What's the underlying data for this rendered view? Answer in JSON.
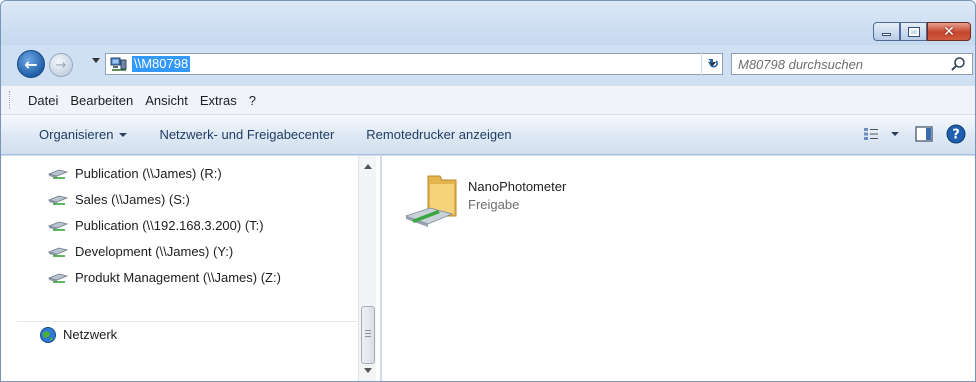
{
  "address": {
    "path": "\\\\M80798",
    "search_placeholder": "M80798 durchsuchen"
  },
  "menubar": {
    "items": [
      "Datei",
      "Bearbeiten",
      "Ansicht",
      "Extras",
      "?"
    ]
  },
  "commandbar": {
    "organize": "Organisieren",
    "network_center": "Netzwerk- und Freigabecenter",
    "remote_printers": "Remotedrucker anzeigen"
  },
  "navpane": {
    "drives": [
      "Publication (\\\\James) (R:)",
      "Sales (\\\\James) (S:)",
      "Publication (\\\\192.168.3.200) (T:)",
      "Development (\\\\James) (Y:)",
      "Produkt Management (\\\\James) (Z:)"
    ],
    "network_label": "Netzwerk"
  },
  "content": {
    "items": [
      {
        "name": "NanoPhotometer",
        "type": "Freigabe"
      }
    ]
  },
  "colors": {
    "accent": "#3399ff",
    "titlebar": "#c6d9ef",
    "close": "#c4452c"
  }
}
